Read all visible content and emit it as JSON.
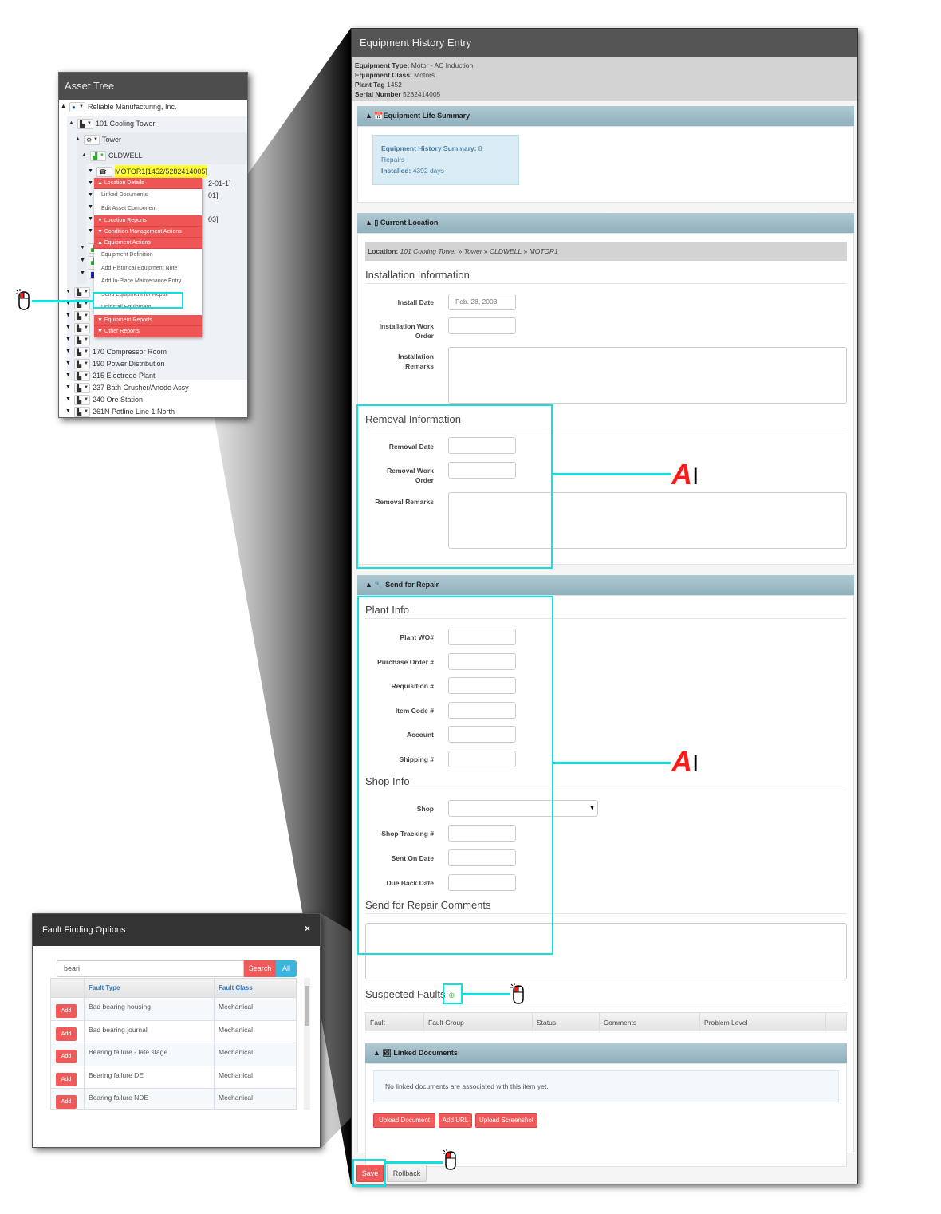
{
  "asset_tree": {
    "title": "Asset Tree",
    "nodes": [
      {
        "label": "Reliable Manufacturing, Inc.",
        "icon": "globe-icon"
      },
      {
        "label": "101 Cooling Tower",
        "icon": "factory-icon"
      },
      {
        "label": "Tower",
        "icon": "gears-icon"
      },
      {
        "label": "CLDWELL",
        "icon": "equipment-group-icon"
      },
      {
        "label": "MOTOR1[1452/5282414005]",
        "icon": "motor-icon",
        "highlighted": true
      }
    ],
    "partial_labels": [
      "2-01-1]",
      "01]",
      "03]"
    ],
    "lower_nodes": [
      "170 Compressor Room",
      "190 Power Distribution",
      "215 Electrode Plant",
      "237 Bath Crusher/Anode Assy",
      "240 Ore Station",
      "261N Potline Line 1 North"
    ]
  },
  "context_menu": {
    "items": [
      {
        "type": "group",
        "label": "Location Details",
        "expanded": true
      },
      {
        "type": "item",
        "label": "Linked Documents"
      },
      {
        "type": "item",
        "label": "Edit Asset Component"
      },
      {
        "type": "group",
        "label": "Location Reports",
        "expanded": false
      },
      {
        "type": "group",
        "label": "Condition Management Actions",
        "expanded": false
      },
      {
        "type": "group",
        "label": "Equipment Actions",
        "expanded": true
      },
      {
        "type": "item",
        "label": "Equipment Definition"
      },
      {
        "type": "item",
        "label": "Add Historical Equipment Note"
      },
      {
        "type": "item",
        "label": "Add In-Place Maintenance Entry"
      },
      {
        "type": "item",
        "label": "Send Equipment for Repair",
        "highlighted": true
      },
      {
        "type": "item",
        "label": "Uninstall Equipment"
      },
      {
        "type": "group",
        "label": "Equipment Reports",
        "expanded": false
      },
      {
        "type": "group",
        "label": "Other Reports",
        "expanded": false
      }
    ]
  },
  "main": {
    "title": "Equipment History Entry",
    "equipment_info": {
      "type_label": "Equipment Type:",
      "type_value": "Motor - AC Induction",
      "class_label": "Equipment Class:",
      "class_value": "Motors",
      "plant_tag_label": "Plant Tag",
      "plant_tag_value": "1452",
      "serial_label": "Serial Number",
      "serial_value": "5282414005"
    },
    "life_summary": {
      "header": "Equipment Life Summary",
      "history_label": "Equipment History Summary:",
      "history_value": "8",
      "repairs_label": "Repairs",
      "installed_label": "Installed:",
      "installed_value": "4392 days"
    },
    "current_location": {
      "header": "Current Location",
      "location_label": "Location:",
      "path": [
        "101 Cooling Tower",
        "Tower",
        "CLDWELL",
        "MOTOR1"
      ],
      "path_sep": "»"
    },
    "installation": {
      "title": "Installation Information",
      "install_date_label": "Install Date",
      "install_date_value": "Feb. 28, 2003",
      "work_order_label_1": "Installation Work",
      "work_order_label_2": "Order",
      "work_order_value": "",
      "remarks_label_1": "Installation",
      "remarks_label_2": "Remarks",
      "remarks_value": ""
    },
    "removal": {
      "title": "Removal Information",
      "date_label": "Removal Date",
      "date_value": "",
      "work_order_label_1": "Removal Work",
      "work_order_label_2": "Order",
      "work_order_value": "",
      "remarks_label": "Removal Remarks",
      "remarks_value": ""
    },
    "send_for_repair": {
      "header": "Send for Repair",
      "plant_info_title": "Plant Info",
      "plant_fields": [
        {
          "label": "Plant WO#",
          "value": ""
        },
        {
          "label": "Purchase Order #",
          "value": ""
        },
        {
          "label": "Requisition #",
          "value": ""
        },
        {
          "label": "Item Code #",
          "value": ""
        },
        {
          "label": "Account",
          "value": ""
        },
        {
          "label": "Shipping #",
          "value": ""
        }
      ],
      "shop_info_title": "Shop Info",
      "shop_label": "Shop",
      "shop_value": "",
      "shop_fields": [
        {
          "label": "Shop Tracking #",
          "value": ""
        },
        {
          "label": "Sent On Date",
          "value": ""
        },
        {
          "label": "Due Back Date",
          "value": ""
        }
      ],
      "comments_title": "Send for Repair Comments",
      "comments_value": "",
      "suspected_faults_title": "Suspected Faults",
      "faults_columns": [
        "Fault",
        "Fault Group",
        "Status",
        "Comments",
        "Problem Level"
      ]
    },
    "linked_documents": {
      "header": "Linked Documents",
      "empty_message": "No linked documents are associated with this item yet.",
      "buttons": [
        "Upload Document",
        "Add URL",
        "Upload Screenshot"
      ]
    },
    "footer": {
      "save_label": "Save",
      "rollback_label": "Rollback"
    }
  },
  "fault_dialog": {
    "title": "Fault Finding Options",
    "close_label": "×",
    "search_value": "beari",
    "search_label": "Search",
    "all_label": "All",
    "columns": [
      "",
      "Fault Type",
      "Fault Class"
    ],
    "add_label": "Add",
    "rows": [
      {
        "type": "Bad bearing housing",
        "class": "Mechanical"
      },
      {
        "type": "Bad bearing journal",
        "class": "Mechanical"
      },
      {
        "type": "Bearing failure - late stage",
        "class": "Mechanical"
      },
      {
        "type": "Bearing failure DE",
        "class": "Mechanical"
      },
      {
        "type": "Bearing failure NDE",
        "class": "Mechanical"
      }
    ]
  },
  "annotations": {
    "text_cursor_glyph": "A",
    "accent_color": "#11e0e0",
    "button_red": "#ef5a5a",
    "all_button_blue": "#3cb4dc"
  }
}
